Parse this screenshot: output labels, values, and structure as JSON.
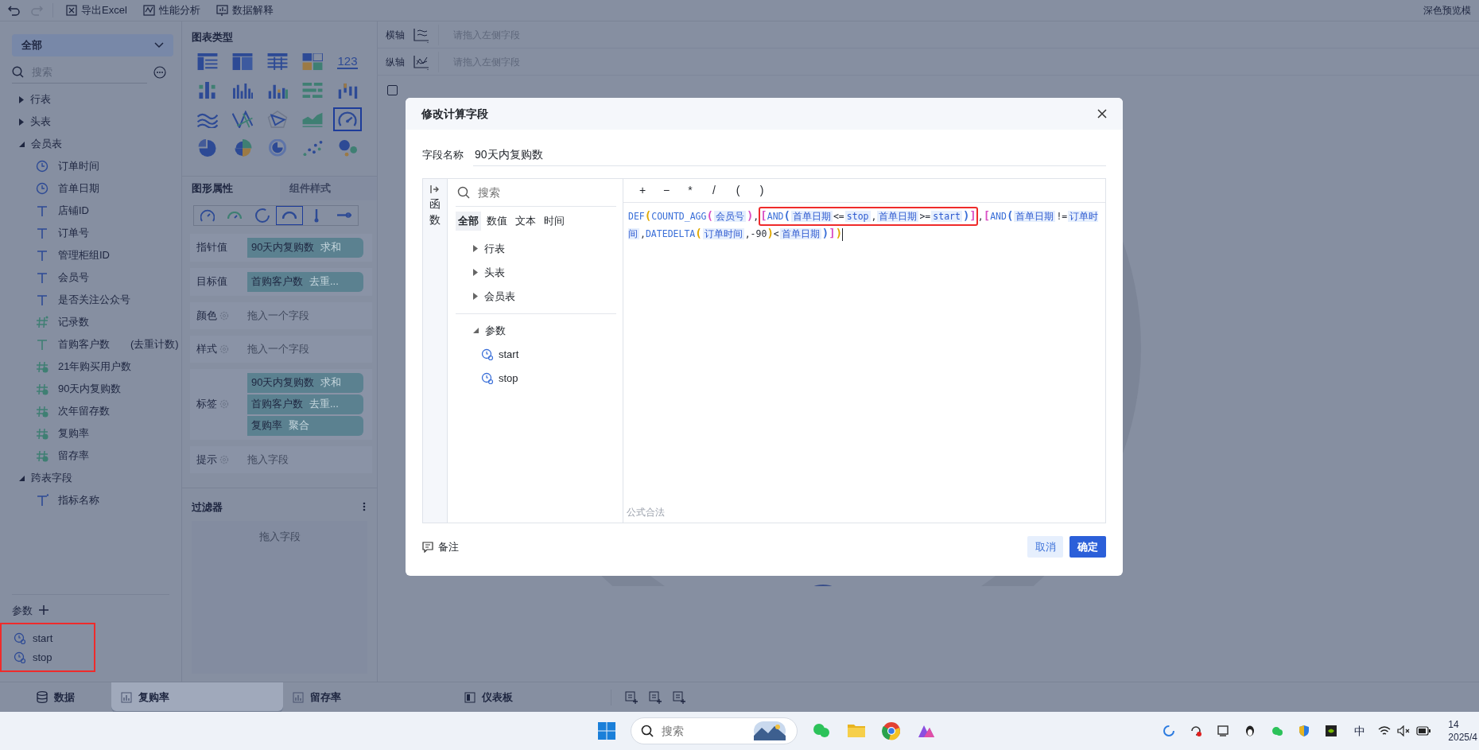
{
  "toolbar": {
    "actions": [
      {
        "kind": "excel",
        "label": "导出Excel"
      },
      {
        "kind": "performance",
        "label": "性能分析"
      },
      {
        "kind": "explain",
        "label": "数据解释"
      }
    ],
    "right_text": "深色预览模"
  },
  "left_panel": {
    "dropdown": "全部",
    "search_placeholder": "搜索",
    "tree": [
      {
        "label": "行表",
        "expanded": false
      },
      {
        "label": "头表",
        "expanded": false
      },
      {
        "label": "会员表",
        "expanded": true,
        "children": [
          {
            "label": "订单时间",
            "kind": "date"
          },
          {
            "label": "首单日期",
            "kind": "date"
          },
          {
            "label": "店铺ID",
            "kind": "text"
          },
          {
            "label": "订单号",
            "kind": "text"
          },
          {
            "label": "管理柜组ID",
            "kind": "text"
          },
          {
            "label": "会员号",
            "kind": "text"
          },
          {
            "label": "是否关注公众号",
            "kind": "text"
          },
          {
            "label": "记录数",
            "kind": "record"
          },
          {
            "label": "首购客户数",
            "kind": "calc-text",
            "note": "(去重计数)"
          },
          {
            "label": "21年购买用户数",
            "kind": "calc-number"
          },
          {
            "label": "90天内复购数",
            "kind": "calc-number"
          },
          {
            "label": "次年留存数",
            "kind": "calc-number"
          },
          {
            "label": "复购率",
            "kind": "calc-number"
          },
          {
            "label": "留存率",
            "kind": "calc-number"
          }
        ]
      },
      {
        "label": "跨表字段",
        "expanded": true,
        "children": [
          {
            "label": "指标名称",
            "kind": "cross-text"
          }
        ]
      }
    ],
    "params_title": "参数",
    "params": {
      "highlighted": true,
      "items": [
        {
          "label": "start"
        },
        {
          "label": "stop"
        }
      ]
    }
  },
  "chart_panel": {
    "title": "图表类型",
    "chart_types": [
      {
        "kind": "table",
        "selected": false
      },
      {
        "kind": "cross-table",
        "selected": false
      },
      {
        "kind": "detail-table",
        "selected": false
      },
      {
        "kind": "treemap",
        "selected": false
      },
      {
        "kind": "number",
        "label": "123",
        "selected": false
      },
      {
        "kind": "dot-bar",
        "selected": false
      },
      {
        "kind": "bar",
        "selected": false
      },
      {
        "kind": "color-bar",
        "selected": false
      },
      {
        "kind": "hbar",
        "selected": false
      },
      {
        "kind": "waterfall",
        "selected": false
      },
      {
        "kind": "line",
        "selected": false
      },
      {
        "kind": "cross-line",
        "selected": false
      },
      {
        "kind": "radar",
        "selected": false
      },
      {
        "kind": "area",
        "selected": false
      },
      {
        "kind": "gauge",
        "selected": true
      },
      {
        "kind": "pie",
        "selected": false
      },
      {
        "kind": "rose",
        "selected": false
      },
      {
        "kind": "donut",
        "selected": false
      },
      {
        "kind": "scatter",
        "selected": false
      },
      {
        "kind": "bubble",
        "selected": false
      }
    ],
    "tabs": [
      {
        "label": "图形属性",
        "selected": true
      },
      {
        "label": "组件样式",
        "selected": false
      }
    ],
    "gauge_styles": [
      {
        "kind": "gauge",
        "selected": false
      },
      {
        "kind": "gauge-small",
        "selected": false
      },
      {
        "kind": "ring",
        "selected": false
      },
      {
        "kind": "semi",
        "selected": true
      },
      {
        "kind": "thermometer",
        "selected": false
      },
      {
        "kind": "slider",
        "selected": false
      }
    ],
    "properties": [
      {
        "label": "指针值",
        "settings": false,
        "chips": [
          {
            "name": "90天内复购数",
            "agg": "求和"
          }
        ]
      },
      {
        "label": "目标值",
        "settings": false,
        "chips": [
          {
            "name": "首购客户数",
            "agg": "去重..."
          }
        ]
      },
      {
        "label": "颜色",
        "settings": true,
        "placeholder": "拖入一个字段"
      },
      {
        "label": "样式",
        "settings": true,
        "placeholder": "拖入一个字段"
      },
      {
        "label": "标签",
        "settings": true,
        "chips": [
          {
            "name": "90天内复购数",
            "agg": "求和"
          },
          {
            "name": "首购客户数",
            "agg": "去重..."
          },
          {
            "name": "复购率",
            "agg": "聚合"
          }
        ]
      },
      {
        "label": "提示",
        "settings": true,
        "placeholder": "拖入字段"
      }
    ],
    "filter": {
      "title": "过滤器",
      "placeholder": "拖入字段"
    }
  },
  "axes": [
    {
      "label": "横轴",
      "kind": "x",
      "placeholder": "请拖入左侧字段"
    },
    {
      "label": "纵轴",
      "kind": "y",
      "placeholder": "请拖入左侧字段"
    }
  ],
  "manual_preview": {
    "checked": false
  },
  "dialog": {
    "title": "修改计算字段",
    "name_label": "字段名称",
    "name_value": "90天内复购数",
    "side_tab": "函数",
    "search_placeholder": "搜索",
    "filters": [
      {
        "label": "全部",
        "selected": true
      },
      {
        "label": "数值",
        "selected": false
      },
      {
        "label": "文本",
        "selected": false
      },
      {
        "label": "时间",
        "selected": false
      }
    ],
    "tree": [
      {
        "label": "行表",
        "expanded": false
      },
      {
        "label": "头表",
        "expanded": false
      },
      {
        "label": "会员表",
        "expanded": false
      },
      {
        "label": "参数",
        "expanded": true,
        "children": [
          {
            "label": "start"
          },
          {
            "label": "stop"
          }
        ]
      }
    ],
    "operators": [
      "+",
      "−",
      "*",
      "/",
      "(",
      ")"
    ],
    "formula": [
      {
        "highlighted": false,
        "tokens": [
          {
            "text": "DEF",
            "kind": "func"
          },
          {
            "text": "(",
            "kind": "paren",
            "color": "#e0a800"
          },
          {
            "text": "COUNTD_AGG",
            "kind": "func"
          },
          {
            "text": "(",
            "kind": "paren",
            "color": "#d94fc4"
          },
          {
            "text": "会员号",
            "kind": "field"
          },
          {
            "text": ")",
            "kind": "paren",
            "color": "#d94fc4"
          },
          {
            "text": ",",
            "kind": "op"
          }
        ]
      },
      {
        "highlighted": true,
        "tokens": [
          {
            "text": "[",
            "kind": "paren",
            "color": "#d94fc4"
          },
          {
            "text": "AND",
            "kind": "func"
          },
          {
            "text": "(",
            "kind": "paren",
            "color": "#3a6fd8"
          },
          {
            "text": "首单日期",
            "kind": "field"
          },
          {
            "text": "<=",
            "kind": "op"
          },
          {
            "text": "stop",
            "kind": "field"
          },
          {
            "text": ",",
            "kind": "op"
          },
          {
            "text": "首单日期",
            "kind": "field"
          },
          {
            "text": ">=",
            "kind": "op"
          },
          {
            "text": "start",
            "kind": "field"
          },
          {
            "text": ")",
            "kind": "paren",
            "color": "#3a6fd8"
          },
          {
            "text": "]",
            "kind": "paren",
            "color": "#d94fc4"
          }
        ]
      },
      {
        "highlighted": false,
        "tokens": [
          {
            "text": ",",
            "kind": "op"
          },
          {
            "text": "[",
            "kind": "paren",
            "color": "#d94fc4"
          },
          {
            "text": "AND",
            "kind": "func"
          },
          {
            "text": "(",
            "kind": "paren",
            "color": "#3a6fd8"
          },
          {
            "text": "首单日期",
            "kind": "field"
          },
          {
            "text": "!=",
            "kind": "op"
          },
          {
            "text": "订单时间",
            "kind": "field"
          },
          {
            "text": ",",
            "kind": "op"
          },
          {
            "text": "DATEDELTA",
            "kind": "func"
          },
          {
            "text": "(",
            "kind": "paren",
            "color": "#e0a800"
          },
          {
            "text": "订单时间",
            "kind": "field"
          },
          {
            "text": ",-90",
            "kind": "op"
          },
          {
            "text": ")",
            "kind": "paren",
            "color": "#e0a800"
          },
          {
            "text": "<",
            "kind": "op"
          },
          {
            "text": "首单日期",
            "kind": "field"
          },
          {
            "text": ")",
            "kind": "paren",
            "color": "#3a6fd8"
          },
          {
            "text": "]",
            "kind": "paren",
            "color": "#d94fc4"
          },
          {
            "text": ")",
            "kind": "paren",
            "color": "#e0a800"
          }
        ]
      }
    ],
    "status": "公式合法",
    "note": "备注",
    "cancel": "取消",
    "ok": "确定"
  },
  "bottom_tabs": [
    {
      "label": "数据",
      "kind": "data",
      "selected": false
    },
    {
      "label": "复购率",
      "kind": "chart",
      "selected": true
    },
    {
      "label": "留存率",
      "kind": "chart",
      "selected": false
    },
    {
      "label": "仪表板",
      "kind": "dashboard",
      "selected": false
    }
  ],
  "taskbar": {
    "search_placeholder": "搜索",
    "ime": "中",
    "time": "14",
    "date": "2025/4"
  }
}
